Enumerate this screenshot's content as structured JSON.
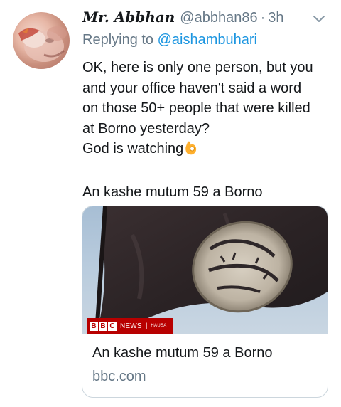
{
  "tweet": {
    "display_name": "Mr. Abbhan",
    "handle": "@abbhan86",
    "separator": "·",
    "time": "3h",
    "replying_prefix": "Replying to",
    "replying_to": "@aishambuhari",
    "body_lines": [
      "OK, here is only one person, but you",
      "and your office haven't said a word",
      "on those 50+ people that were killed",
      "at Borno yesterday?",
      "God is watching"
    ],
    "emoji": "ok-hand-emoji",
    "link_text": "An kashe mutum 59 a Borno"
  },
  "card": {
    "title": "An kashe mutum 59 a Borno",
    "domain": "bbc.com",
    "image_badge": {
      "blocks": [
        "B",
        "B",
        "C"
      ],
      "news": "NEWS",
      "separator": "|",
      "section": "HAUSA"
    }
  },
  "colors": {
    "secondary_text": "#657786",
    "link": "#1b95e0",
    "border": "#ccd6dd",
    "bbc_red": "#b80000"
  }
}
